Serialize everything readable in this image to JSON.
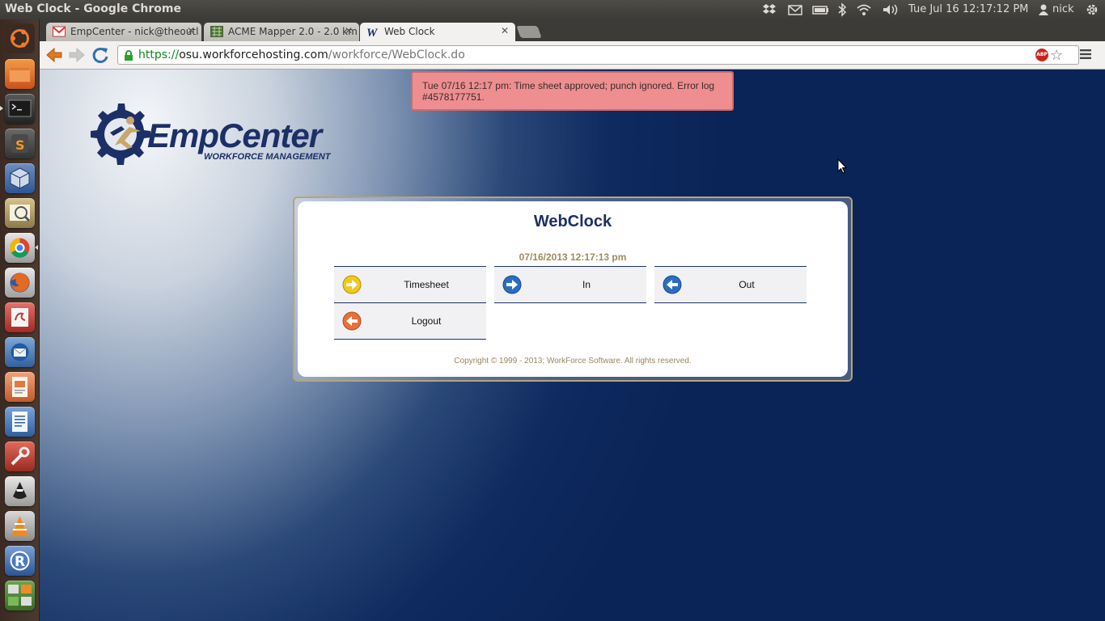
{
  "window": {
    "title": "Web Clock - Google Chrome"
  },
  "panel_tray": {
    "datetime": "Tue Jul 16 12:17:12 PM",
    "user": "nick",
    "icons": [
      "dropbox-icon",
      "mail-icon",
      "battery-icon",
      "bluetooth-icon",
      "wifi-icon",
      "volume-icon",
      "user-icon",
      "session-gear-icon"
    ]
  },
  "launcher": {
    "items": [
      "ubuntu-dash",
      "files",
      "terminal",
      "sublime-text",
      "virtualbox",
      "image-viewer",
      "chrome",
      "firefox",
      "evince",
      "thunderbird",
      "impress",
      "writer",
      "system-settings",
      "inkscape",
      "vlc",
      "rstudio",
      "workspace-switcher"
    ]
  },
  "browser": {
    "tabs": [
      {
        "label": "EmpCenter - nick@theoutl",
        "favicon": "gmail-icon",
        "active": false
      },
      {
        "label": "ACME Mapper 2.0 - 2.0 km",
        "favicon": "acme-icon",
        "active": false
      },
      {
        "label": "Web Clock",
        "favicon": "workforce-w-icon",
        "active": true
      }
    ],
    "url": {
      "scheme": "https://",
      "host": "osu.workforcehosting.com",
      "path": "/workforce/WebClock.do"
    }
  },
  "page": {
    "notification": "Tue 07/16 12:17 pm: Time sheet approved; punch ignored. Error log #4578177751.",
    "logo": {
      "name": "EmpCenter",
      "tagline": "WORKFORCE MANAGEMENT"
    },
    "webclock": {
      "title": "WebClock",
      "datetime": "07/16/2013 12:17:13 pm",
      "buttons": [
        {
          "label": "Timesheet",
          "icon": "arrow-right-yellow-icon"
        },
        {
          "label": "In",
          "icon": "arrow-right-blue-icon"
        },
        {
          "label": "Out",
          "icon": "arrow-left-blue-icon"
        },
        {
          "label": "Logout",
          "icon": "arrow-left-red-icon"
        }
      ],
      "copyright": "Copyright © 1999 - 2013; WorkForce Software. All rights reserved."
    }
  },
  "colors": {
    "brand_navy": "#1c2f66",
    "brand_gold": "#a08a5a",
    "notification_bg": "#ee8e90",
    "page_dark_blue": "#0a2457"
  }
}
